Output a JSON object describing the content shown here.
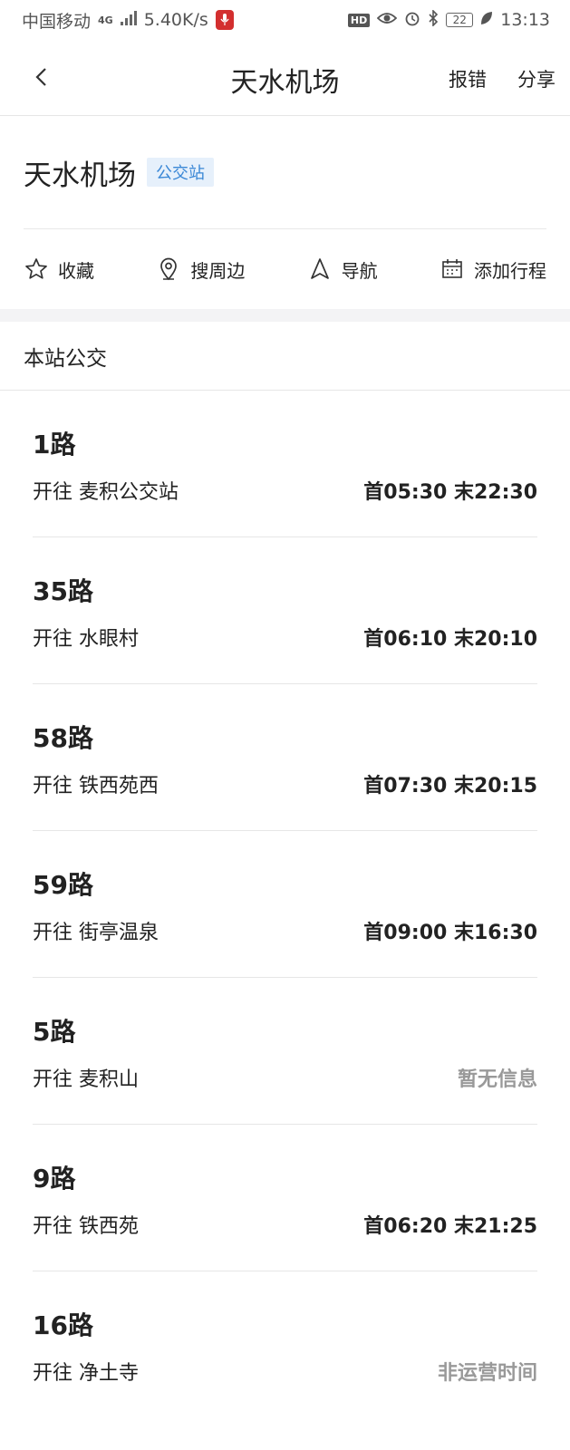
{
  "status_bar": {
    "carrier": "中国移动",
    "network": "4G",
    "speed": "5.40K/s",
    "battery": "22",
    "time": "13:13"
  },
  "nav": {
    "title": "天水机场",
    "report_label": "报错",
    "share_label": "分享"
  },
  "station": {
    "name": "天水机场",
    "tag": "公交站"
  },
  "actions": [
    {
      "label": "收藏",
      "icon": "star-icon"
    },
    {
      "label": "搜周边",
      "icon": "location-pin-icon"
    },
    {
      "label": "导航",
      "icon": "navigation-arrow-icon"
    },
    {
      "label": "添加行程",
      "icon": "calendar-icon"
    }
  ],
  "section_title": "本站公交",
  "routes": [
    {
      "name": "1路",
      "dest": "开往  麦积公交站",
      "time": "首05:30 末22:30"
    },
    {
      "name": "35路",
      "dest": "开往  水眼村",
      "time": "首06:10 末20:10"
    },
    {
      "name": "58路",
      "dest": "开往  铁西苑西",
      "time": "首07:30 末20:15"
    },
    {
      "name": "59路",
      "dest": "开往  街亭温泉",
      "time": "首09:00 末16:30"
    },
    {
      "name": "5路",
      "dest": "开往  麦积山",
      "time": "暂无信息",
      "muted": true
    },
    {
      "name": "9路",
      "dest": "开往  铁西苑",
      "time": "首06:20 末21:25"
    },
    {
      "name": "16路",
      "dest": "开往  净土寺",
      "time": "非运营时间",
      "muted": true
    }
  ],
  "colors": {
    "accent_tag": "#3a87d6",
    "muted_text": "#999999",
    "mic_red": "#d32f2f"
  }
}
